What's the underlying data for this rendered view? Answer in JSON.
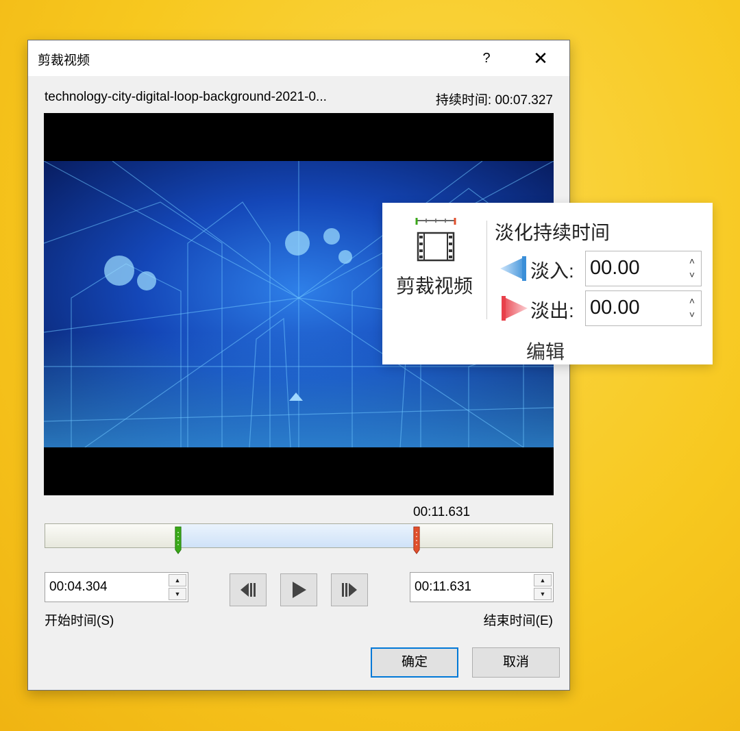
{
  "dialog": {
    "title": "剪裁视频",
    "help_label": "?",
    "close_label": "✕",
    "file_name": "technology-city-digital-loop-background-2021-0...",
    "duration_text": "持续时间: 00:07.327",
    "timeline_end_label": "00:11.631",
    "timeline": {
      "start_fraction": 0.265,
      "end_fraction": 0.735
    },
    "start_time": {
      "value": "00:04.304",
      "label": "开始时间(S)"
    },
    "end_time": {
      "value": "00:11.631",
      "label": "结束时间(E)"
    },
    "ok_label": "确定",
    "cancel_label": "取消",
    "spin_up": "▲",
    "spin_down": "▼"
  },
  "ribbon": {
    "trim_label": "剪裁视频",
    "fade_title": "淡化持续时间",
    "fade_in_label": "淡入:",
    "fade_in_value": "00.00",
    "fade_out_label": "淡出:",
    "fade_out_value": "00.00",
    "group_label": "编辑",
    "spin_up": "˄",
    "spin_down": "˅"
  },
  "colors": {
    "background": "#f7c81f",
    "selection": "#cfe2f8",
    "start_marker": "#3aa818",
    "end_marker": "#e0502e",
    "fade_in": "#3a8fd8",
    "fade_out": "#e8404a",
    "primary_border": "#0078d7"
  },
  "icons": [
    "help-icon",
    "close-icon",
    "previous-frame-icon",
    "play-icon",
    "next-frame-icon",
    "trim-video-icon",
    "fade-in-icon",
    "fade-out-icon"
  ]
}
